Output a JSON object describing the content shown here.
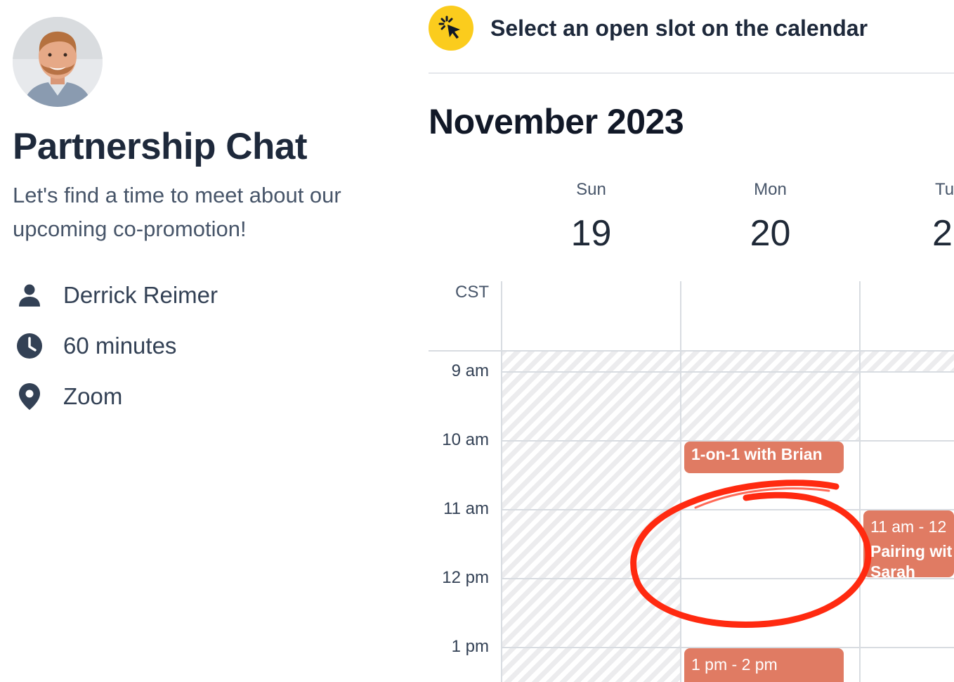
{
  "event": {
    "title": "Partnership Chat",
    "description": "Let's find a time to meet about our upcoming co-promotion!",
    "host": "Derrick Reimer",
    "duration": "60 minutes",
    "location": "Zoom"
  },
  "header": {
    "hint": "Select an open slot on the calendar"
  },
  "calendar": {
    "month_label": "November 2023",
    "timezone": "CST",
    "days": [
      {
        "name": "Sun",
        "number": "19"
      },
      {
        "name": "Mon",
        "number": "20"
      },
      {
        "name": "Tu",
        "number": "2"
      }
    ],
    "hours": [
      "9 am",
      "10 am",
      "11 am",
      "12 pm",
      "1 pm"
    ],
    "events": [
      {
        "title": "1-on-1 with Brian"
      },
      {
        "time": "11 am - 12",
        "title": "Pairing wit",
        "extra": "Sarah"
      },
      {
        "time": "1 pm - 2 pm"
      }
    ]
  },
  "colors": {
    "accent_yellow": "#fbcc1d",
    "event": "#e07b63",
    "annotation": "#ff2a10"
  }
}
